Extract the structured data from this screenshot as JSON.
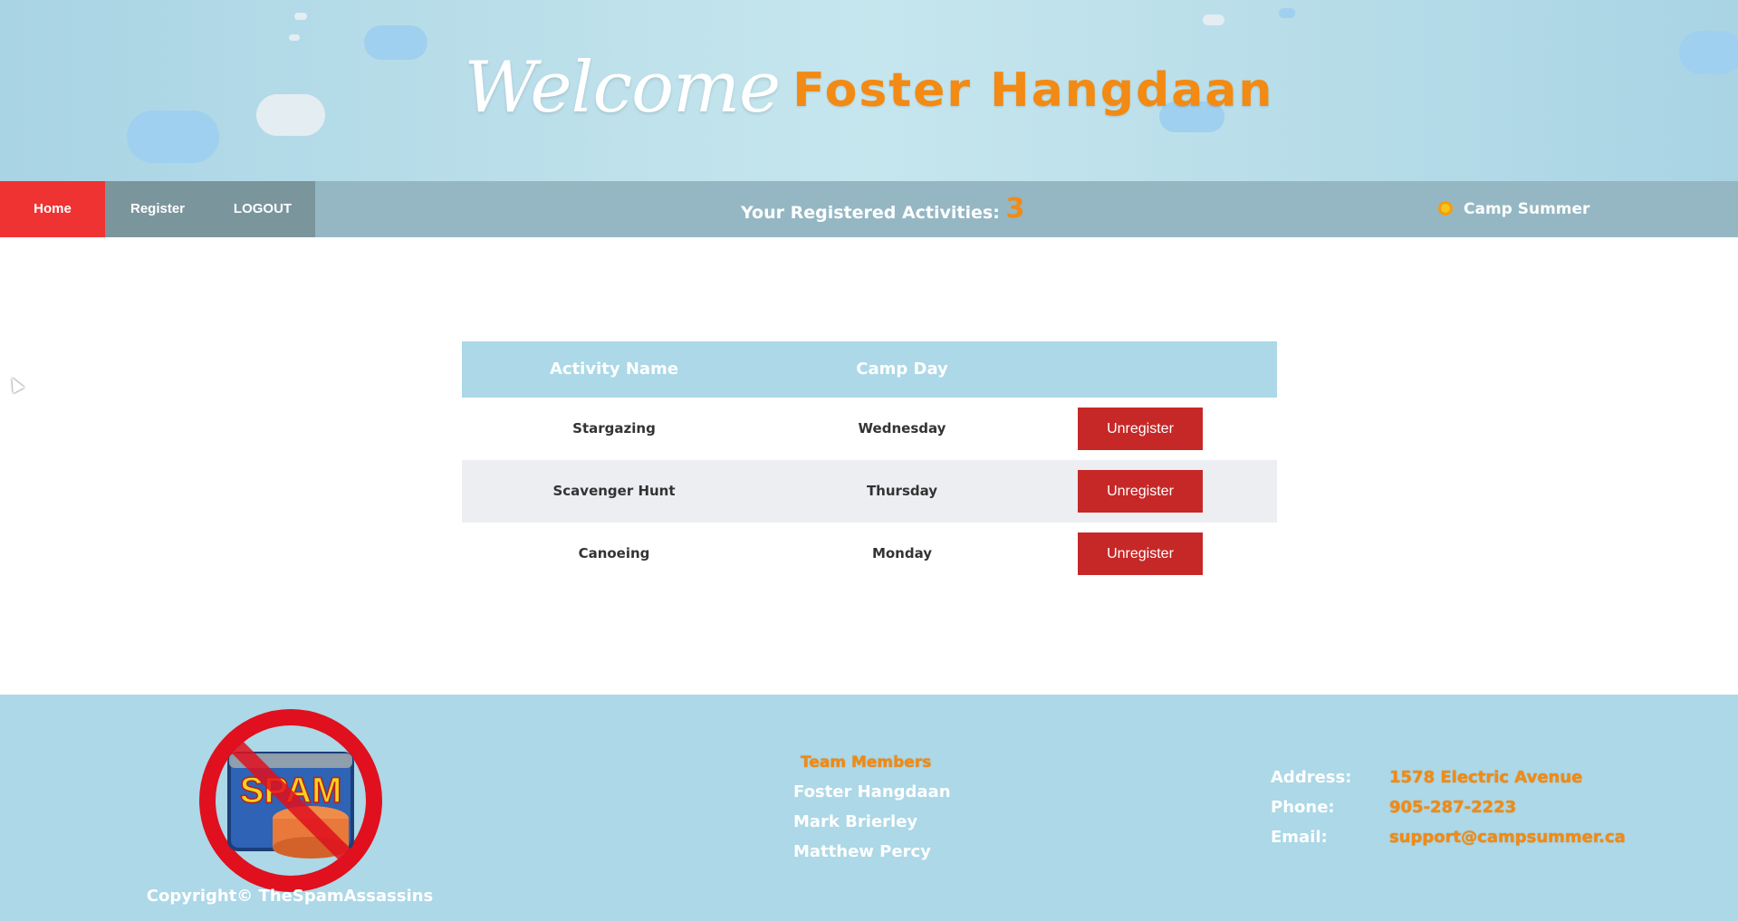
{
  "header": {
    "welcome": "Welcome",
    "user_name": "Foster Hangdaan"
  },
  "nav": {
    "home": "Home",
    "register": "Register",
    "logout": "LOGOUT",
    "registered_label": "Your Registered Activities:",
    "registered_count": "3",
    "brand": "Camp Summer"
  },
  "table": {
    "headers": [
      "Activity Name",
      "Camp Day",
      ""
    ],
    "rows": [
      {
        "activity": "Stargazing",
        "day": "Wednesday",
        "action": "Unregister"
      },
      {
        "activity": "Scavenger Hunt",
        "day": "Thursday",
        "action": "Unregister"
      },
      {
        "activity": "Canoeing",
        "day": "Monday",
        "action": "Unregister"
      }
    ]
  },
  "footer": {
    "logo_text": "SPAM",
    "copyright": "Copyright© TheSpamAssassins",
    "team_title": "Team Members",
    "team_members": [
      "Foster Hangdaan",
      "Mark Brierley",
      "Matthew Percy"
    ],
    "contact": {
      "address_label": "Address:",
      "address": "1578 Electric Avenue",
      "phone_label": "Phone:",
      "phone": "905-287-2223",
      "email_label": "Email:",
      "email": "support@campsummer.ca"
    }
  },
  "colors": {
    "accent_orange": "#f28a14",
    "nav_active_red": "#ef3232",
    "button_red": "#c62828",
    "header_blue": "#acd8e7"
  }
}
